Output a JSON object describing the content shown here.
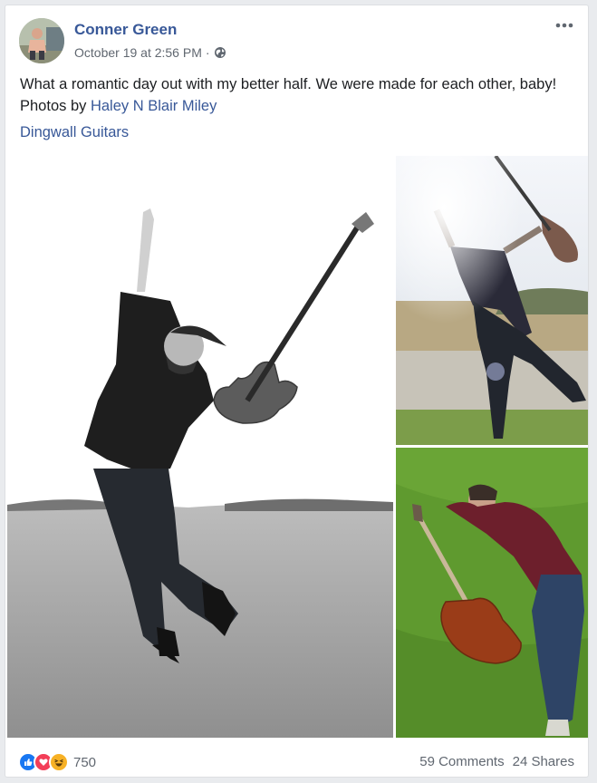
{
  "post": {
    "author": "Conner Green",
    "timestamp": "October 19 at 2:56 PM",
    "separator": "·",
    "privacy_icon": "globe-icon",
    "text_main": "What a romantic day out with my better half. We were made for each other, baby! Photos by ",
    "text_link": "Haley N Blair Miley",
    "tag": "Dingwall Guitars"
  },
  "reactions": {
    "icons": [
      "like-icon",
      "love-icon",
      "haha-icon"
    ],
    "count": "750"
  },
  "footer": {
    "comments": "59 Comments",
    "shares": "24 Shares"
  },
  "colors": {
    "link": "#385898",
    "like": "#1877f2",
    "love": "#f33e58",
    "haha": "#f7b125"
  }
}
